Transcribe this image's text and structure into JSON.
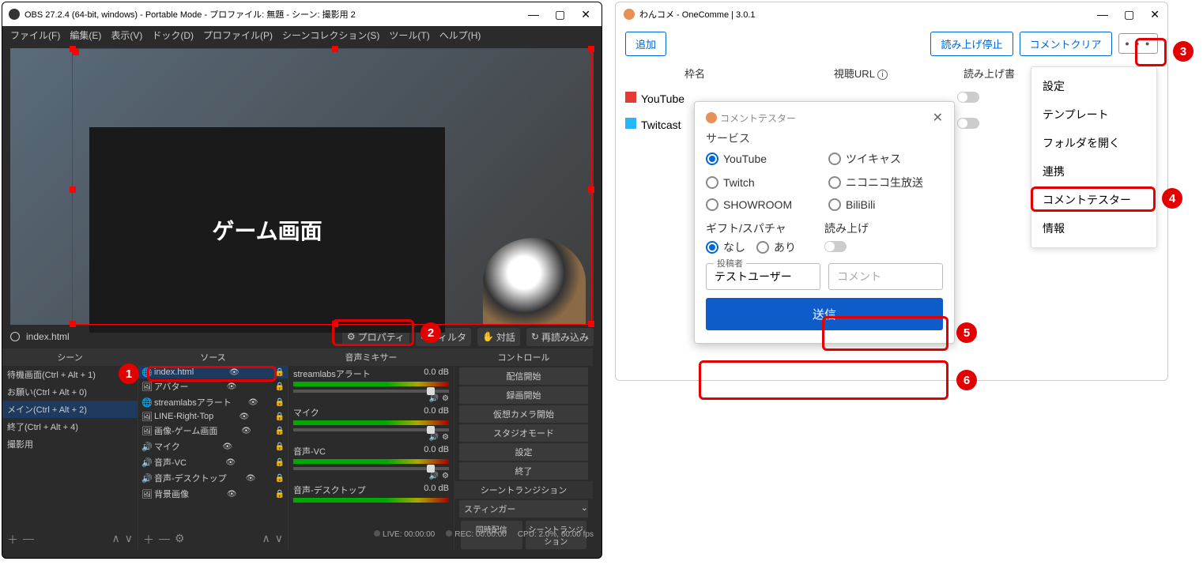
{
  "obs": {
    "title": "OBS 27.2.4 (64-bit, windows) - Portable Mode - プロファイル: 無題 - シーン: 撮影用 2",
    "menu": [
      "ファイル(F)",
      "編集(E)",
      "表示(V)",
      "ドック(D)",
      "プロファイル(P)",
      "シーンコレクション(S)",
      "ツール(T)",
      "ヘルプ(H)"
    ],
    "preview_text": "ゲーム画面",
    "selected_source": "index.html",
    "source_buttons": {
      "props": "プロパティ",
      "filter": "フィルタ",
      "interact": "対話",
      "reload": "再読み込み"
    },
    "panel_headers": {
      "scenes": "シーン",
      "sources": "ソース",
      "mixer": "音声ミキサー",
      "controls": "コントロール",
      "transition": "シーントランジション"
    },
    "scenes": [
      {
        "label": "待機画面(Ctrl + Alt + 1)"
      },
      {
        "label": "お願い(Ctrl + Alt + 0)"
      },
      {
        "label": "メイン(Ctrl + Alt + 2)",
        "selected": true
      },
      {
        "label": "終了(Ctrl + Alt + 4)"
      },
      {
        "label": "撮影用"
      }
    ],
    "sources": [
      {
        "label": "index.html",
        "selected": true
      },
      {
        "label": "アバター"
      },
      {
        "label": "streamlabsアラート"
      },
      {
        "label": "LINE-Right-Top"
      },
      {
        "label": "画像-ゲーム画面"
      },
      {
        "label": "マイク"
      },
      {
        "label": "音声-VC"
      },
      {
        "label": "音声-デスクトップ"
      },
      {
        "label": "背景画像"
      }
    ],
    "mixer": [
      {
        "name": "streamlabsアラート",
        "db": "0.0 dB"
      },
      {
        "name": "マイク",
        "db": "0.0 dB"
      },
      {
        "name": "音声-VC",
        "db": "0.0 dB"
      },
      {
        "name": "音声-デスクトップ",
        "db": "0.0 dB"
      }
    ],
    "controls": [
      "配信開始",
      "録画開始",
      "仮想カメラ開始",
      "スタジオモード",
      "設定",
      "終了"
    ],
    "transition": {
      "value": "スティンガー",
      "tabs": [
        "同時配信",
        "シーントランジション"
      ]
    },
    "footer_add_remove": "＋ —",
    "footer_updown": "∧ ∨",
    "status": {
      "live": "LIVE: 00:00:00",
      "rec": "REC: 00:00:00",
      "cpu": "CPU: 2.0%, 60.00 fps"
    }
  },
  "oc": {
    "title": "わんコメ - OneComme | 3.0.1",
    "toolbar": {
      "add": "追加",
      "stop_tts": "読み上げ停止",
      "clear": "コメントクリア",
      "more": "• • •"
    },
    "columns": {
      "name": "枠名",
      "url": "視聴URL",
      "tts": "読み上げ書"
    },
    "rows": [
      {
        "color": "#e53935",
        "name": "YouTube"
      },
      {
        "color": "#29b6f6",
        "name": "Twitcast"
      }
    ],
    "menu": [
      "設定",
      "テンプレート",
      "フォルダを開く",
      "連携",
      "コメントテスター",
      "情報"
    ]
  },
  "ct": {
    "title": "コメントテスター",
    "service_label": "サービス",
    "services": [
      "YouTube",
      "ツイキャス",
      "Twitch",
      "ニコニコ生放送",
      "SHOWROOM",
      "BiliBili"
    ],
    "gift_label": "ギフト/スパチャ",
    "tts_label": "読み上げ",
    "gift_none": "なし",
    "gift_yes": "あり",
    "poster_label": "投稿者",
    "poster_value": "テストユーザー",
    "comment_placeholder": "コメント",
    "submit": "送信"
  },
  "ann": {
    "1": "1",
    "2": "2",
    "3": "3",
    "4": "4",
    "5": "5",
    "6": "6"
  }
}
